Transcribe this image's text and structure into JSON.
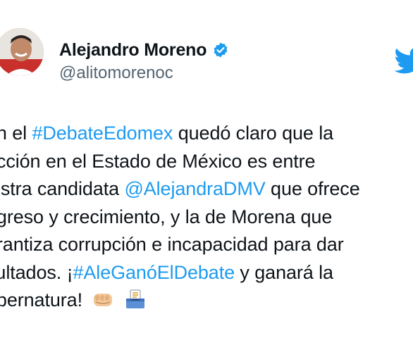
{
  "author": {
    "display_name": "Alejandro Moreno",
    "handle": "@alitomorenoc",
    "verified": true
  },
  "icons": {
    "verified": "verified-badge-icon",
    "brand": "twitter-bird-icon",
    "emoji_fist": "oncoming-fist-icon",
    "emoji_ballot": "ballot-box-icon"
  },
  "colors": {
    "link": "#1d9bf0",
    "text": "#0f1419",
    "secondary": "#536471",
    "verified": "#1d9bf0"
  },
  "tweet": {
    "line1_pre": "on el ",
    "line1_tag": "#DebateEdomex",
    "line1_post": " quedó claro que la",
    "line2": "ección en el Estado de México es entre",
    "line3_pre": "iestra candidata ",
    "line3_mention": "@AlejandraDMV",
    "line3_post": " que ofrece",
    "line4": "ogreso y crecimiento, y la de Morena que",
    "line5": "arantiza corrupción e incapacidad para dar",
    "line6_pre": "sultados. ¡",
    "line6_tag": "#AleGanóElDebate",
    "line6_post": " y ganará la",
    "line7": "ubernatura!"
  }
}
